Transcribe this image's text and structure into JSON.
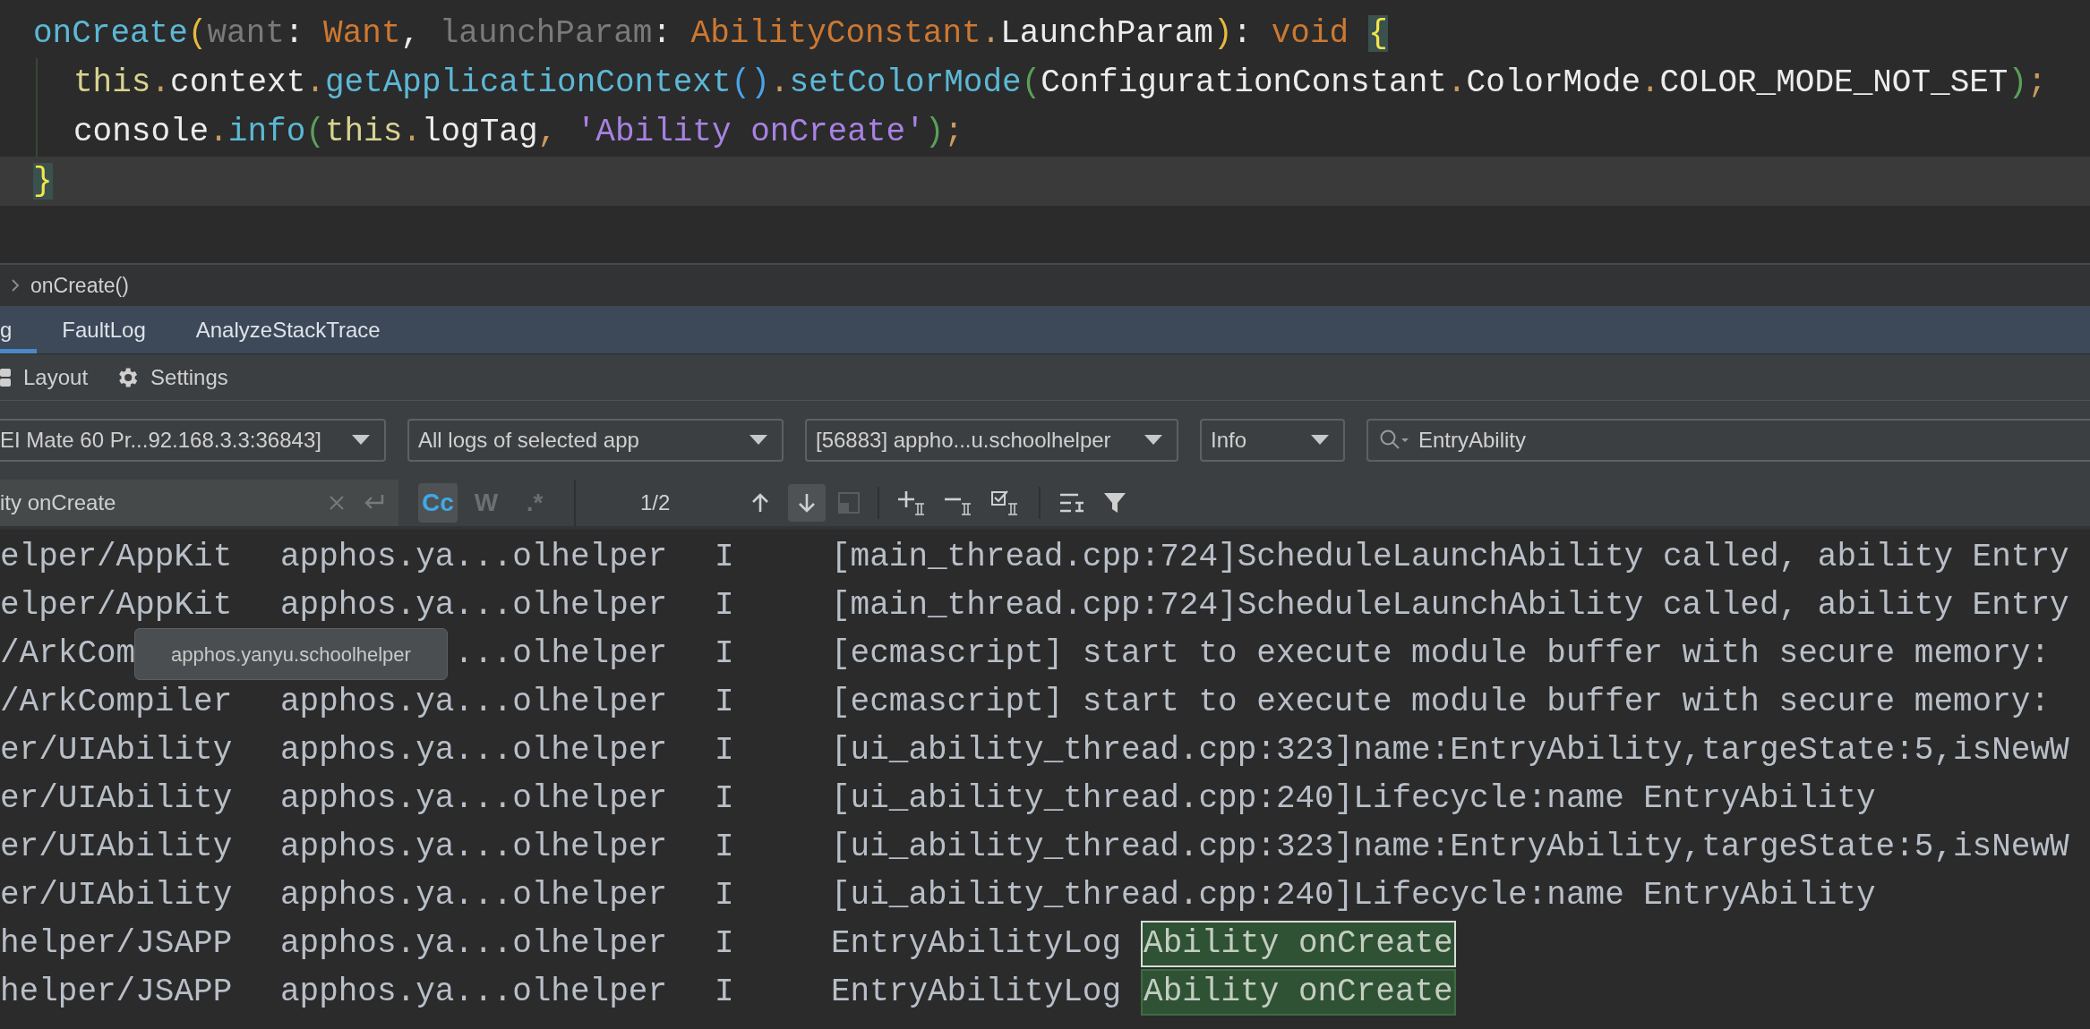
{
  "editor": {
    "lines": [
      {
        "current": false,
        "tokens": [
          {
            "kind": "fn",
            "text": "onCreate"
          },
          {
            "kind": "paren1",
            "text": "("
          },
          {
            "kind": "param",
            "text": "want"
          },
          {
            "kind": "plain",
            "text": ": "
          },
          {
            "kind": "type",
            "text": "Want"
          },
          {
            "kind": "plain",
            "text": ", "
          },
          {
            "kind": "param",
            "text": "launchParam"
          },
          {
            "kind": "plain",
            "text": ": "
          },
          {
            "kind": "type",
            "text": "AbilityConstant"
          },
          {
            "kind": "punct",
            "text": "."
          },
          {
            "kind": "plain",
            "text": "LaunchParam"
          },
          {
            "kind": "paren1",
            "text": ")"
          },
          {
            "kind": "plain",
            "text": ": "
          },
          {
            "kind": "keyword",
            "text": "void"
          },
          {
            "kind": "brace",
            "text": "{"
          }
        ],
        "children": [
          {
            "current": false,
            "tokens": [
              {
                "kind": "this",
                "text": "this"
              },
              {
                "kind": "punct",
                "text": "."
              },
              {
                "kind": "plain",
                "text": "context"
              },
              {
                "kind": "punct",
                "text": "."
              },
              {
                "kind": "fn",
                "text": "getApplicationContext"
              },
              {
                "kind": "paren2",
                "text": "()"
              },
              {
                "kind": "punct",
                "text": "."
              },
              {
                "kind": "fn",
                "text": "setColorMode"
              },
              {
                "kind": "paren3",
                "text": "("
              },
              {
                "kind": "plain",
                "text": "ConfigurationConstant"
              },
              {
                "kind": "punct",
                "text": "."
              },
              {
                "kind": "plain",
                "text": "ColorMode"
              },
              {
                "kind": "punct",
                "text": "."
              },
              {
                "kind": "plain",
                "text": "COLOR_MODE_NOT_SET"
              },
              {
                "kind": "paren3",
                "text": ")"
              },
              {
                "kind": "punct",
                "text": ";"
              }
            ]
          },
          {
            "current": false,
            "tokens": [
              {
                "kind": "plain",
                "text": "console"
              },
              {
                "kind": "punct",
                "text": "."
              },
              {
                "kind": "fn",
                "text": "info"
              },
              {
                "kind": "paren3",
                "text": "("
              },
              {
                "kind": "this",
                "text": "this"
              },
              {
                "kind": "punct",
                "text": "."
              },
              {
                "kind": "plain",
                "text": "logTag"
              },
              {
                "kind": "punct",
                "text": ", "
              },
              {
                "kind": "string",
                "text": "'Ability onCreate'"
              },
              {
                "kind": "paren3",
                "text": ")"
              },
              {
                "kind": "punct",
                "text": ";"
              }
            ]
          }
        ]
      },
      {
        "current": true,
        "tokens": [
          {
            "kind": "brace",
            "text": "}"
          }
        ]
      }
    ]
  },
  "breadcrumb": {
    "items": [
      "onCreate()"
    ]
  },
  "tabs": [
    {
      "label": "g",
      "selected": true
    },
    {
      "label": "FaultLog",
      "selected": false
    },
    {
      "label": "AnalyzeStackTrace",
      "selected": false
    }
  ],
  "toolbar": [
    {
      "kind": "layout",
      "label": "Layout"
    },
    {
      "kind": "settings",
      "label": "Settings"
    }
  ],
  "filters": {
    "device": "EI Mate 60 Pr...92.168.3.3:36843]",
    "log_scope": "All logs of selected app",
    "process": "[56883] appho...u.schoolhelper",
    "level": "Info",
    "search": {
      "value": "EntryAbility"
    }
  },
  "find": {
    "query": "ity onCreate",
    "options": [
      {
        "label": "Cc",
        "selected": true
      },
      {
        "label": "W",
        "selected": false
      },
      {
        "label": ".*",
        "selected": false
      }
    ],
    "match_count": "1/2",
    "nav": [
      {
        "kind": "up",
        "selected": false
      },
      {
        "kind": "down",
        "selected": true
      }
    ]
  },
  "log_rows": [
    {
      "tag": "elper/AppKit",
      "app": "apphos.ya...olhelper",
      "level": "I",
      "message": "[main_thread.cpp:724]ScheduleLaunchAbility called, ability Entry"
    },
    {
      "tag": "elper/AppKit",
      "app": "apphos.ya...olhelper",
      "level": "I",
      "message": "[main_thread.cpp:724]ScheduleLaunchAbility called, ability Entry"
    },
    {
      "tag": "/ArkCom",
      "app": "...olhelper",
      "level": "I",
      "message": "[ecmascript] start to execute module buffer with secure memory:"
    },
    {
      "tag": "/ArkCompiler",
      "app": "apphos.ya...olhelper",
      "level": "I",
      "message": "[ecmascript] start to execute module buffer with secure memory:"
    },
    {
      "tag": "er/UIAbility",
      "app": "apphos.ya...olhelper",
      "level": "I",
      "message": "[ui_ability_thread.cpp:323]name:EntryAbility,targeState:5,isNewW"
    },
    {
      "tag": "er/UIAbility",
      "app": "apphos.ya...olhelper",
      "level": "I",
      "message": "[ui_ability_thread.cpp:240]Lifecycle:name EntryAbility"
    },
    {
      "tag": "er/UIAbility",
      "app": "apphos.ya...olhelper",
      "level": "I",
      "message": "[ui_ability_thread.cpp:323]name:EntryAbility,targeState:5,isNewW"
    },
    {
      "tag": "er/UIAbility",
      "app": "apphos.ya...olhelper",
      "level": "I",
      "message": "[ui_ability_thread.cpp:240]Lifecycle:name EntryAbility"
    },
    {
      "tag": "helper/JSAPP",
      "app": "apphos.ya...olhelper",
      "level": "I",
      "message": "EntryAbilityLog",
      "match": "Ability onCreate",
      "match_current": true
    },
    {
      "tag": "helper/JSAPP",
      "app": "apphos.ya...olhelper",
      "level": "I",
      "message": "EntryAbilityLog",
      "match": "Ability onCreate",
      "match_current": false
    }
  ],
  "tooltip": {
    "text": "apphos.yanyu.schoolhelper"
  }
}
